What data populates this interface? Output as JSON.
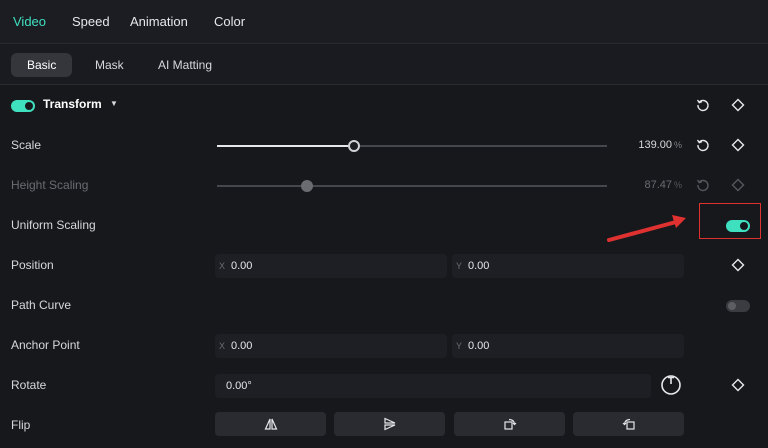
{
  "top_tabs": [
    {
      "label": "Video",
      "active": true
    },
    {
      "label": "Speed",
      "active": false
    },
    {
      "label": "Animation",
      "active": false
    },
    {
      "label": "Color",
      "active": false
    }
  ],
  "sub_tabs": [
    {
      "label": "Basic",
      "active": true
    },
    {
      "label": "Mask",
      "active": false
    },
    {
      "label": "AI Matting",
      "active": false
    }
  ],
  "transform": {
    "title": "Transform",
    "enabled": true
  },
  "scale": {
    "label": "Scale",
    "value": "139.00",
    "unit": "%",
    "fraction": 0.35
  },
  "height_scaling": {
    "label": "Height Scaling",
    "value": "87.47",
    "unit": "%",
    "fraction": 0.23
  },
  "uniform_scaling": {
    "label": "Uniform Scaling",
    "enabled": true
  },
  "position": {
    "label": "Position",
    "x_axis": "X",
    "x_value": "0.00",
    "y_axis": "Y",
    "y_value": "0.00"
  },
  "path_curve": {
    "label": "Path Curve",
    "enabled": false
  },
  "anchor_point": {
    "label": "Anchor Point",
    "x_axis": "X",
    "x_value": "0.00",
    "y_axis": "Y",
    "y_value": "0.00"
  },
  "rotate": {
    "label": "Rotate",
    "value": "0.00°"
  },
  "flip": {
    "label": "Flip",
    "buttons": [
      "flip-horizontal-icon",
      "flip-vertical-icon",
      "rotate-clockwise-icon",
      "rotate-counterclockwise-icon"
    ]
  },
  "colors": {
    "accent": "#3fe0c0",
    "annotation": "#e03131"
  }
}
